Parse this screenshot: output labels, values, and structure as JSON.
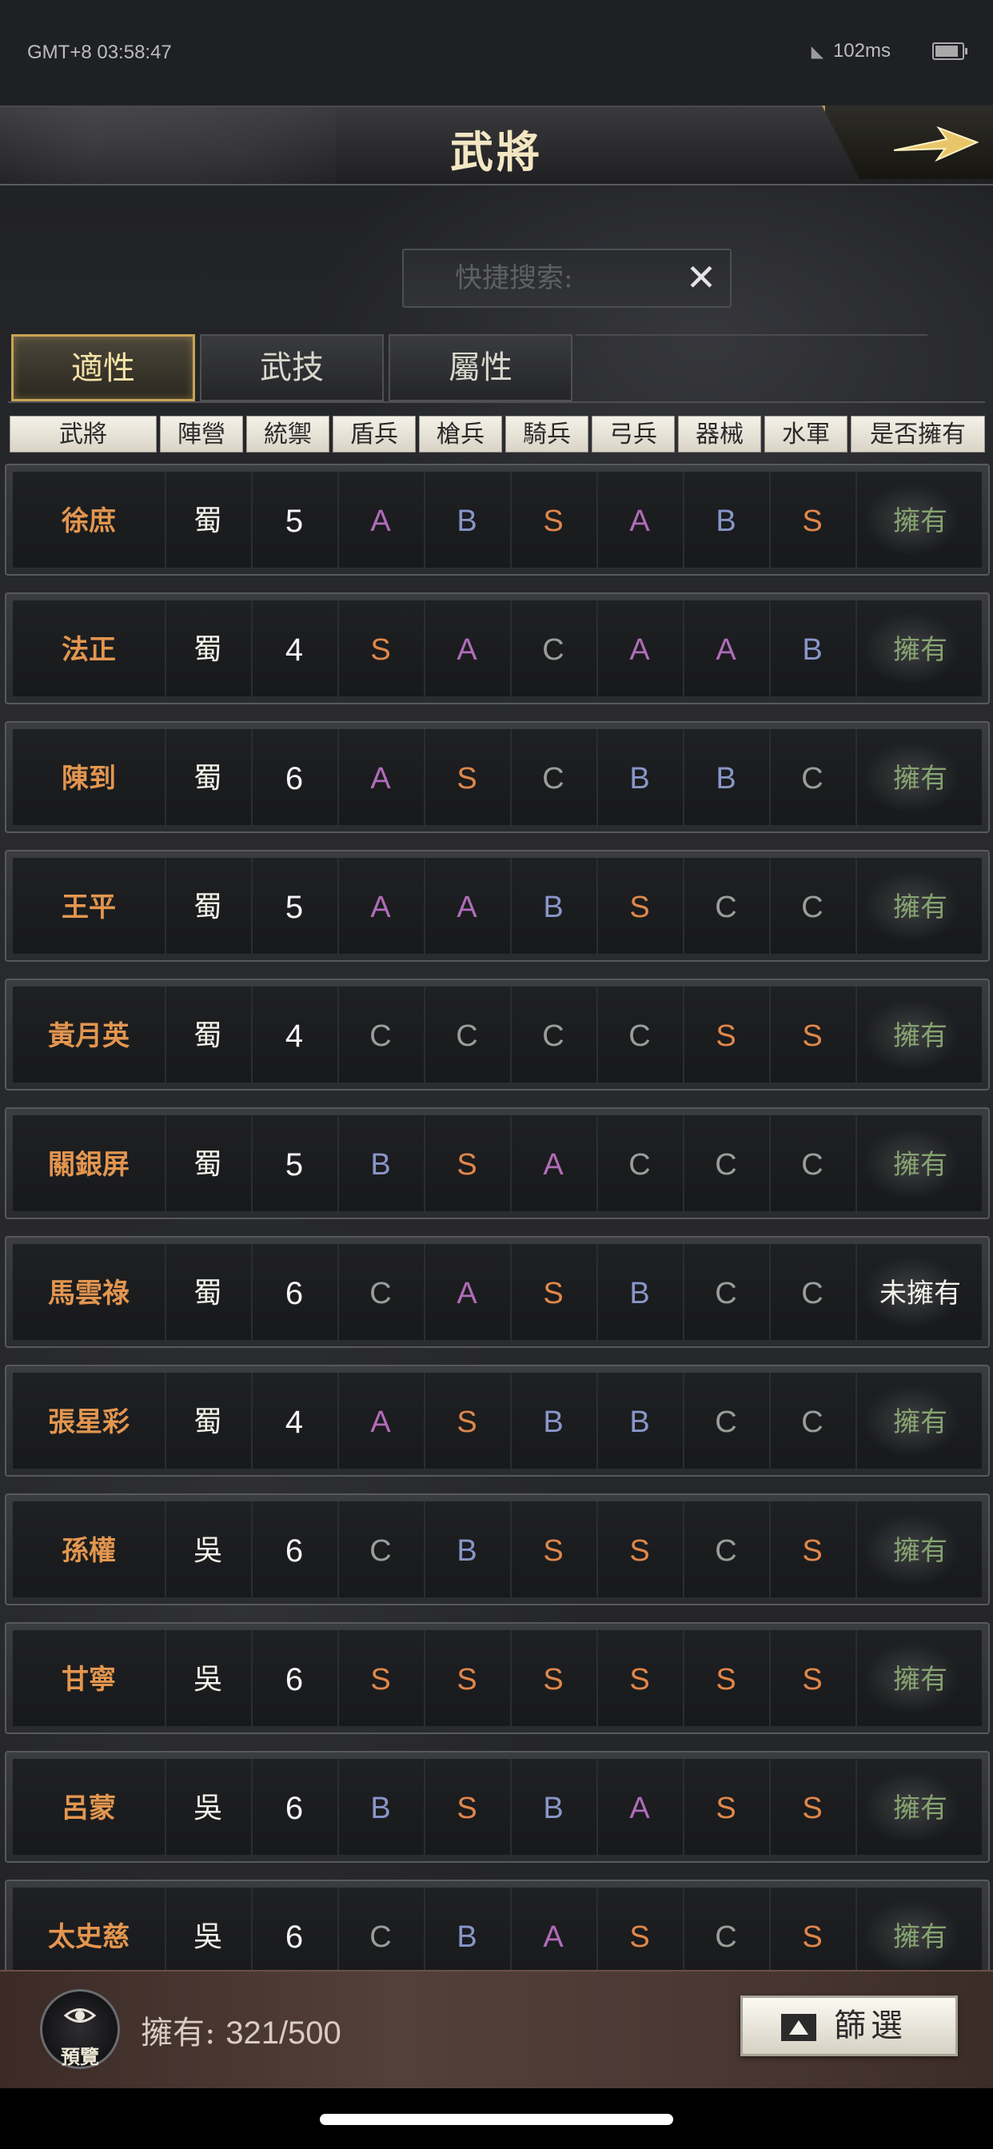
{
  "status_bar": {
    "time": "GMT+8 03:58:47",
    "latency": "102ms"
  },
  "header": {
    "title": "武將"
  },
  "search": {
    "placeholder": "快捷搜索:"
  },
  "tabs": [
    {
      "label": "適性",
      "active": true
    },
    {
      "label": "武技",
      "active": false
    },
    {
      "label": "屬性",
      "active": false
    }
  ],
  "columns": [
    "武將",
    "陣營",
    "統禦",
    "盾兵",
    "槍兵",
    "騎兵",
    "弓兵",
    "器械",
    "水軍",
    "是否擁有"
  ],
  "rows": [
    {
      "name": "徐庶",
      "camp": "蜀",
      "command": "5",
      "grades": [
        "A",
        "B",
        "S",
        "A",
        "B",
        "S"
      ],
      "owned": "擁有"
    },
    {
      "name": "法正",
      "camp": "蜀",
      "command": "4",
      "grades": [
        "S",
        "A",
        "C",
        "A",
        "A",
        "B"
      ],
      "owned": "擁有"
    },
    {
      "name": "陳到",
      "camp": "蜀",
      "command": "6",
      "grades": [
        "A",
        "S",
        "C",
        "B",
        "B",
        "C"
      ],
      "owned": "擁有"
    },
    {
      "name": "王平",
      "camp": "蜀",
      "command": "5",
      "grades": [
        "A",
        "A",
        "B",
        "S",
        "C",
        "C"
      ],
      "owned": "擁有"
    },
    {
      "name": "黃月英",
      "camp": "蜀",
      "command": "4",
      "grades": [
        "C",
        "C",
        "C",
        "C",
        "S",
        "S"
      ],
      "owned": "擁有"
    },
    {
      "name": "關銀屏",
      "camp": "蜀",
      "command": "5",
      "grades": [
        "B",
        "S",
        "A",
        "C",
        "C",
        "C"
      ],
      "owned": "擁有"
    },
    {
      "name": "馬雲祿",
      "camp": "蜀",
      "command": "6",
      "grades": [
        "C",
        "A",
        "S",
        "B",
        "C",
        "C"
      ],
      "owned": "未擁有"
    },
    {
      "name": "張星彩",
      "camp": "蜀",
      "command": "4",
      "grades": [
        "A",
        "S",
        "B",
        "B",
        "C",
        "C"
      ],
      "owned": "擁有"
    },
    {
      "name": "孫權",
      "camp": "吳",
      "command": "6",
      "grades": [
        "C",
        "B",
        "S",
        "S",
        "C",
        "S"
      ],
      "owned": "擁有"
    },
    {
      "name": "甘寧",
      "camp": "吳",
      "command": "6",
      "grades": [
        "S",
        "S",
        "S",
        "S",
        "S",
        "S"
      ],
      "owned": "擁有"
    },
    {
      "name": "呂蒙",
      "camp": "吳",
      "command": "6",
      "grades": [
        "B",
        "S",
        "B",
        "A",
        "S",
        "S"
      ],
      "owned": "擁有"
    },
    {
      "name": "太史慈",
      "camp": "吳",
      "command": "6",
      "grades": [
        "C",
        "B",
        "A",
        "S",
        "C",
        "S"
      ],
      "owned": "擁有"
    }
  ],
  "grade_colors": {
    "S": "#e0874a",
    "A": "#b16cb9",
    "B": "#8896c9",
    "C": "#9a9d98"
  },
  "footer": {
    "preview_label": "預覽",
    "owned_label": "擁有:",
    "owned_count": "321/500",
    "filter_label": "篩選"
  },
  "icons": [
    "wifi-icon",
    "battery-icon",
    "arrow-right-icon",
    "close-icon",
    "eye-icon",
    "triangle-up-icon"
  ]
}
